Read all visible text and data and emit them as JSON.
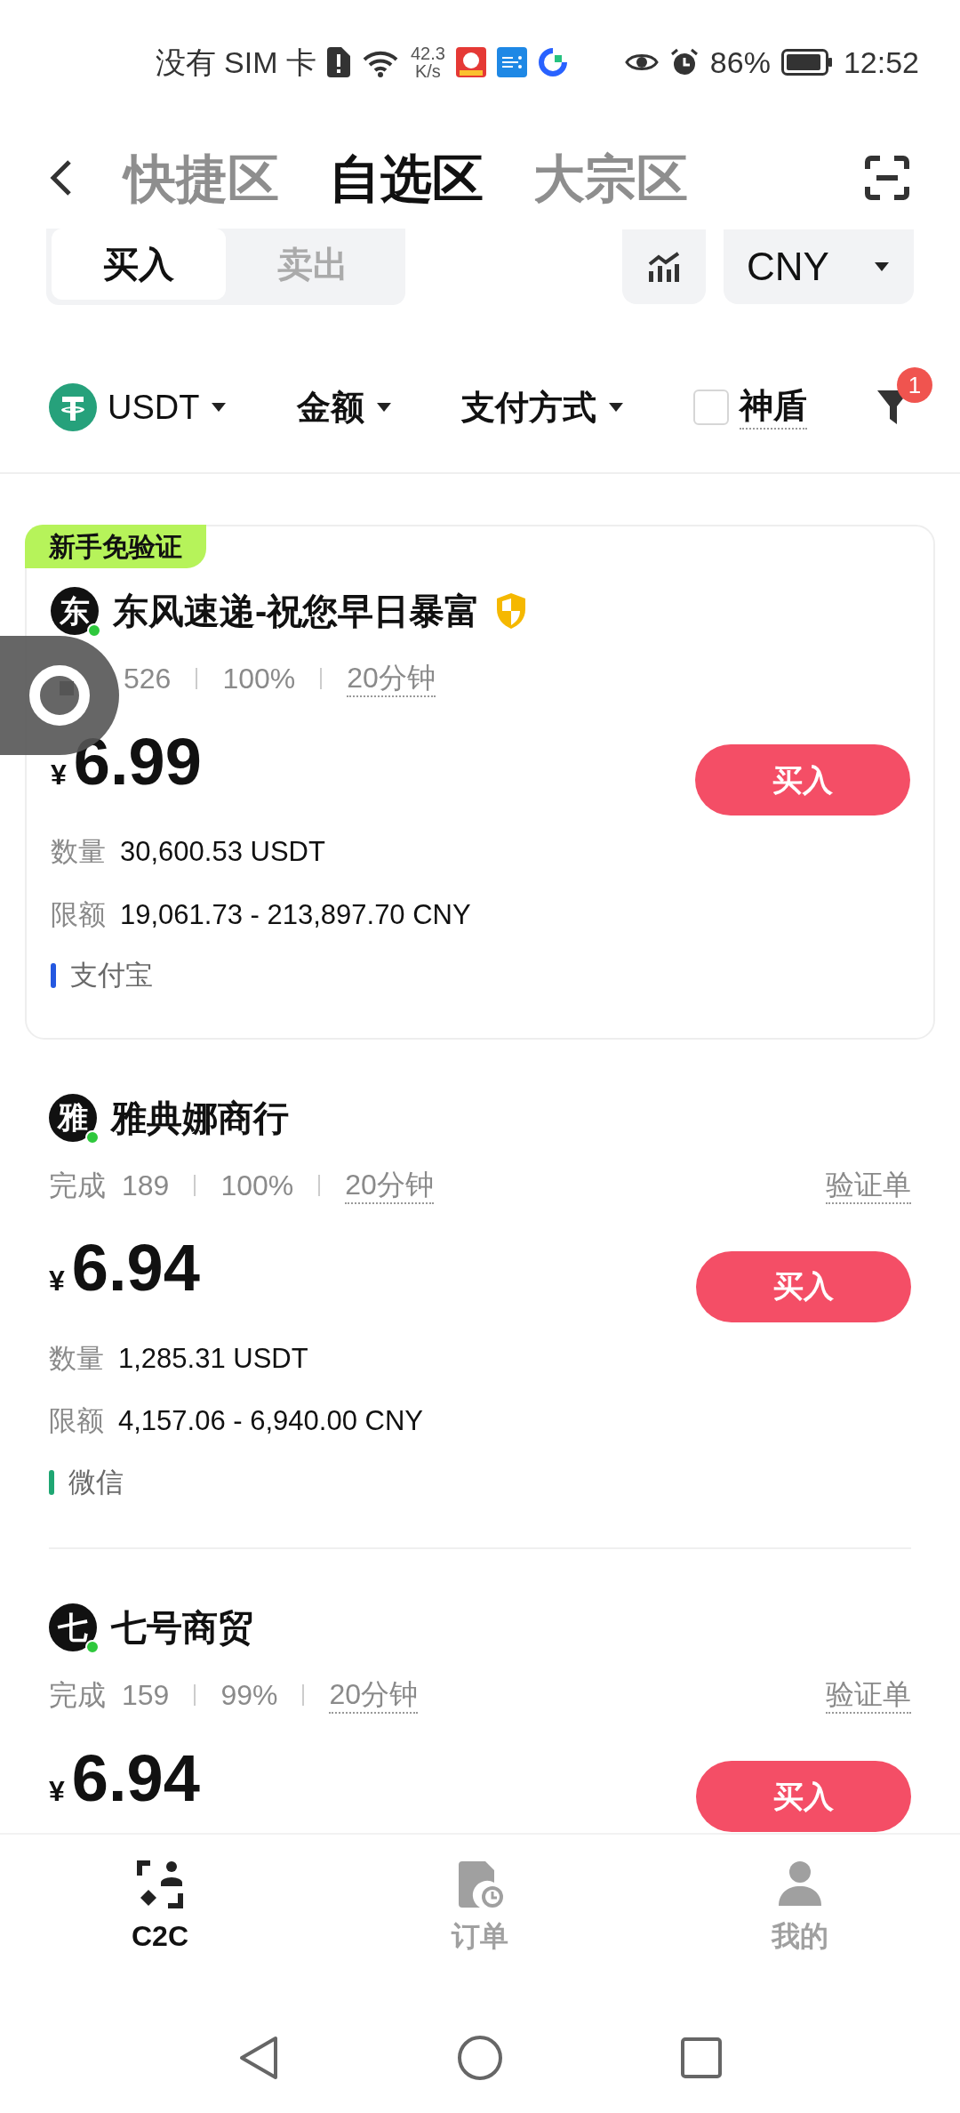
{
  "status_bar": {
    "carrier": "没有 SIM 卡",
    "speed_value": "42.3",
    "speed_unit": "K/s",
    "battery": "86%",
    "time": "12:52"
  },
  "header": {
    "tabs": [
      {
        "label": "快捷区",
        "selected": false
      },
      {
        "label": "自选区",
        "selected": true
      },
      {
        "label": "大宗区",
        "selected": false
      }
    ]
  },
  "trade_toggle": [
    {
      "label": "买入",
      "selected": true
    },
    {
      "label": "卖出",
      "selected": false
    }
  ],
  "currency": "CNY",
  "filters": [
    {
      "kind": "coin",
      "label": "USDT"
    },
    {
      "kind": "dropdown",
      "label": "金额"
    },
    {
      "kind": "dropdown",
      "label": "支付方式"
    },
    {
      "kind": "checkbox",
      "label": "神盾",
      "checked": false
    }
  ],
  "filter_badge": "1",
  "offers": [
    {
      "tag": "新手免验证",
      "avatar": "东",
      "name": "东风速递-祝您早日暴富",
      "verified": true,
      "completed": "526",
      "rate": "100%",
      "time": "20分钟",
      "currency_symbol": "¥",
      "price": "6.99",
      "qty_label": "数量",
      "qty": "30,600.53 USDT",
      "limit_label": "限额",
      "limit": "19,061.73 - 213,897.70 CNY",
      "payment": {
        "label": "支付宝",
        "color": "#2458e0"
      },
      "button": "买入"
    },
    {
      "avatar": "雅",
      "name": "雅典娜商行",
      "completed_label": "完成",
      "completed": "189",
      "rate": "100%",
      "time": "20分钟",
      "verify_label": "验证单",
      "currency_symbol": "¥",
      "price": "6.94",
      "qty_label": "数量",
      "qty": "1,285.31 USDT",
      "limit_label": "限额",
      "limit": "4,157.06 - 6,940.00 CNY",
      "payment": {
        "label": "微信",
        "color": "#1ea672"
      },
      "button": "买入"
    },
    {
      "avatar": "七",
      "name": "七号商贸",
      "completed_label": "完成",
      "completed": "159",
      "rate": "99%",
      "time": "20分钟",
      "verify_label": "验证单",
      "currency_symbol": "¥",
      "price": "6.94",
      "button": "买入"
    }
  ],
  "nav": [
    {
      "kind": "c2c",
      "label": "C2C",
      "selected": true
    },
    {
      "kind": "orders",
      "label": "订单",
      "selected": false
    },
    {
      "kind": "profile",
      "label": "我的",
      "selected": false
    }
  ]
}
